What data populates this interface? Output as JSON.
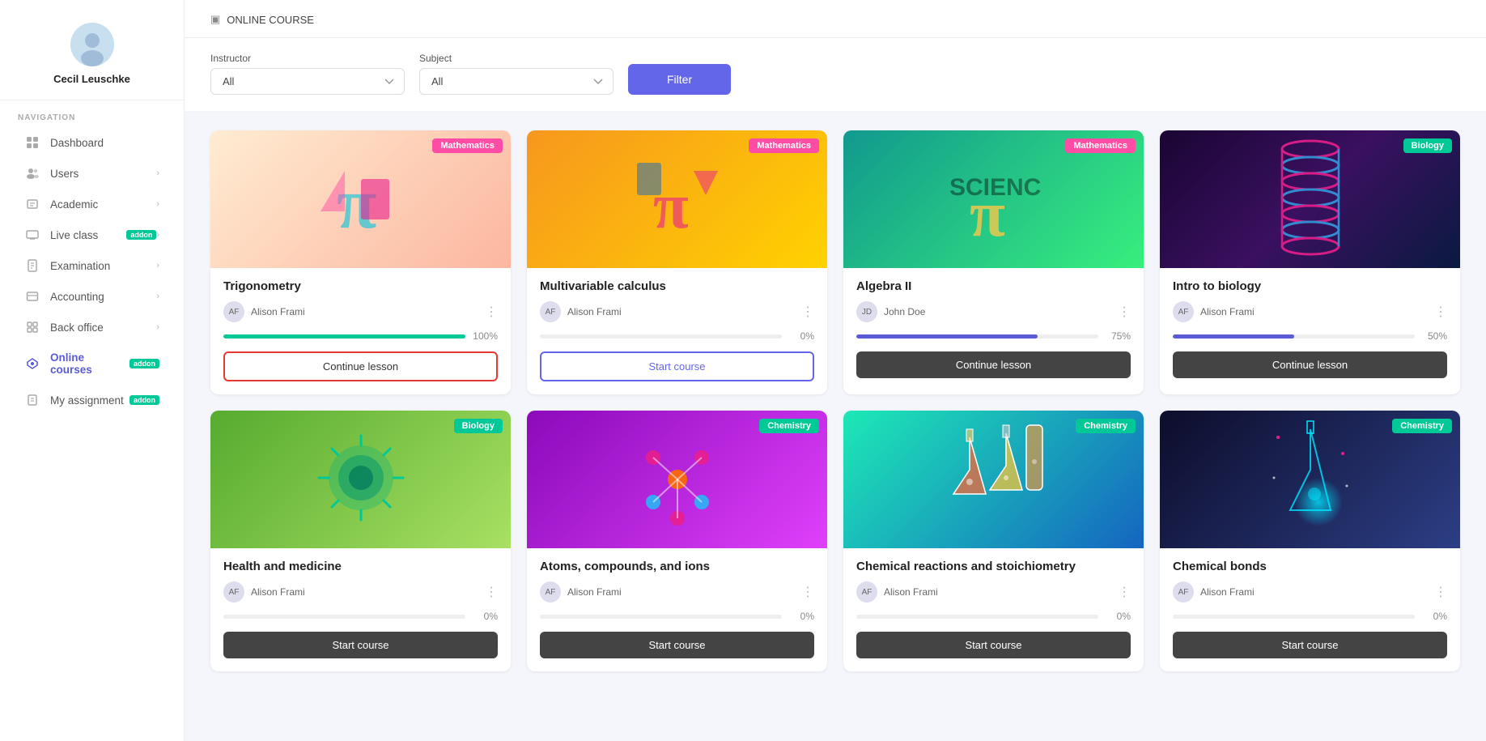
{
  "sidebar": {
    "username": "Cecil Leuschke",
    "nav_label": "NAVIGATION",
    "items": [
      {
        "id": "dashboard",
        "label": "Dashboard",
        "icon": "dashboard-icon",
        "has_arrow": false,
        "active": false,
        "addon": null
      },
      {
        "id": "users",
        "label": "Users",
        "icon": "users-icon",
        "has_arrow": true,
        "active": false,
        "addon": null
      },
      {
        "id": "academic",
        "label": "Academic",
        "icon": "academic-icon",
        "has_arrow": true,
        "active": false,
        "addon": null
      },
      {
        "id": "liveclass",
        "label": "Live class",
        "icon": "liveclass-icon",
        "has_arrow": true,
        "active": false,
        "addon": "addon"
      },
      {
        "id": "examination",
        "label": "Examination",
        "icon": "exam-icon",
        "has_arrow": true,
        "active": false,
        "addon": null
      },
      {
        "id": "accounting",
        "label": "Accounting",
        "icon": "accounting-icon",
        "has_arrow": true,
        "active": false,
        "addon": null
      },
      {
        "id": "backoffice",
        "label": "Back office",
        "icon": "backoffice-icon",
        "has_arrow": true,
        "active": false,
        "addon": null
      },
      {
        "id": "online-courses",
        "label": "Online courses",
        "icon": "courses-icon",
        "has_arrow": false,
        "active": true,
        "addon": "addon"
      },
      {
        "id": "my-assignment",
        "label": "My assignment",
        "icon": "assignment-icon",
        "has_arrow": false,
        "active": false,
        "addon": "addon"
      }
    ]
  },
  "header": {
    "breadcrumb_icon": "▣",
    "breadcrumb_text": "ONLINE COURSE"
  },
  "filters": {
    "instructor_label": "Instructor",
    "instructor_placeholder": "All",
    "subject_label": "Subject",
    "subject_placeholder": "All",
    "filter_button": "Filter"
  },
  "courses": [
    {
      "id": "trig",
      "title": "Trigonometry",
      "subject": "Mathematics",
      "badge_class": "badge-math",
      "subject_color": "#ff4da6",
      "instructor": "Alison Frami",
      "progress": 100,
      "progress_color": "prog-green",
      "action": "Continue lesson",
      "action_class": "btn-continue-outline",
      "img_class": "img-trig",
      "img_symbol": "π"
    },
    {
      "id": "calc",
      "title": "Multivariable calculus",
      "subject": "Mathematics",
      "badge_class": "badge-math",
      "subject_color": "#ff4da6",
      "instructor": "Alison Frami",
      "progress": 0,
      "progress_color": "prog-gray",
      "action": "Start course",
      "action_class": "btn-start-outline",
      "img_class": "img-calc",
      "img_symbol": "π"
    },
    {
      "id": "alg2",
      "title": "Algebra II",
      "subject": "Mathematics",
      "badge_class": "badge-math",
      "subject_color": "#ff4da6",
      "instructor": "John Doe",
      "progress": 75,
      "progress_color": "prog-blue",
      "action": "Continue lesson",
      "action_class": "btn-dark",
      "img_class": "img-alg",
      "img_symbol": "π"
    },
    {
      "id": "bio",
      "title": "Intro to biology",
      "subject": "Biology",
      "badge_class": "badge-bio",
      "subject_color": "#00c896",
      "instructor": "Alison Frami",
      "progress": 50,
      "progress_color": "prog-blue",
      "action": "Continue lesson",
      "action_class": "btn-dark",
      "img_class": "img-bio",
      "img_symbol": "🧬"
    },
    {
      "id": "health",
      "title": "Health and medicine",
      "subject": "Biology",
      "badge_class": "badge-bio",
      "subject_color": "#00c896",
      "instructor": "Alison Frami",
      "progress": 0,
      "progress_color": "prog-gray",
      "action": "Start course",
      "action_class": "btn-dark",
      "img_class": "img-health",
      "img_symbol": "🦠"
    },
    {
      "id": "atoms",
      "title": "Atoms, compounds, and ions",
      "subject": "Chemistry",
      "badge_class": "badge-chem",
      "subject_color": "#00c896",
      "instructor": "Alison Frami",
      "progress": 0,
      "progress_color": "prog-gray",
      "action": "Start course",
      "action_class": "btn-dark",
      "img_class": "img-atoms",
      "img_symbol": "⚛"
    },
    {
      "id": "chem-react",
      "title": "Chemical reactions and stoichiometry",
      "subject": "Chemistry",
      "badge_class": "badge-chem",
      "subject_color": "#00c896",
      "instructor": "Alison Frami",
      "progress": 0,
      "progress_color": "prog-gray",
      "action": "Start course",
      "action_class": "btn-dark",
      "img_class": "img-chem-react",
      "img_symbol": "⚗"
    },
    {
      "id": "bonds",
      "title": "Chemical bonds",
      "subject": "Chemistry",
      "badge_class": "badge-chem",
      "subject_color": "#00c896",
      "instructor": "Alison Frami",
      "progress": 0,
      "progress_color": "prog-gray",
      "action": "Start course",
      "action_class": "btn-dark",
      "img_class": "img-bonds",
      "img_symbol": "🧪"
    }
  ],
  "addon_label": "addon"
}
